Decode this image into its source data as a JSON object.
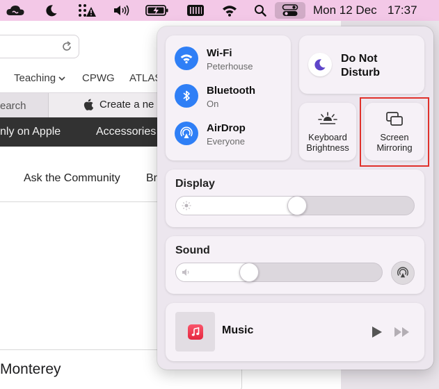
{
  "menubar": {
    "date": "Mon 12 Dec",
    "time": "17:37",
    "icons": [
      "creative-cloud-icon",
      "moon-icon",
      "network-alert-icon",
      "volume-icon",
      "battery-charging-icon",
      "keyboard-icon",
      "wifi-icon",
      "search-icon",
      "control-centre-icon"
    ]
  },
  "browser": {
    "favourites": {
      "teaching": "Teaching",
      "cpwg": "CPWG",
      "atlas": "ATLAS"
    },
    "tabs": {
      "search_partial": "earch",
      "create": "Create a ne"
    },
    "nav": {
      "only_on_apple": "nly on Apple",
      "accessories": "Accessories"
    },
    "subnav": {
      "ask_community": "Ask the Community",
      "br_partial": "Br"
    },
    "heading": "Monterey"
  },
  "control_centre": {
    "wifi": {
      "title": "Wi-Fi",
      "subtitle": "Peterhouse"
    },
    "bluetooth": {
      "title": "Bluetooth",
      "subtitle": "On"
    },
    "airdrop": {
      "title": "AirDrop",
      "subtitle": "Everyone"
    },
    "dnd": {
      "label_line1": "Do Not",
      "label_line2": "Disturb"
    },
    "keyboard": {
      "line1": "Keyboard",
      "line2": "Brightness"
    },
    "mirroring": {
      "line1": "Screen",
      "line2": "Mirroring"
    },
    "display": {
      "title": "Display",
      "level": 0.51
    },
    "sound": {
      "title": "Sound",
      "level": 0.34
    },
    "music": {
      "title": "Music"
    },
    "accent": "#2f7ff6",
    "highlight_color": "#e0312b"
  }
}
